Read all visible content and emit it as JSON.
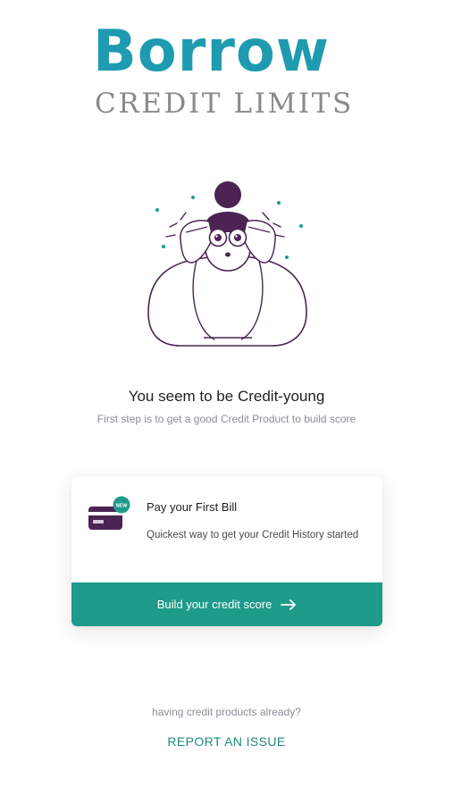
{
  "brand": {
    "title": "Borrow",
    "subtitle": "CREDIT LIMITS"
  },
  "hero": {
    "headline": "You seem to be Credit-young",
    "subline": "First step is to get a good Credit Product to build score"
  },
  "card": {
    "badge": "NEW",
    "title": "Pay your First Bill",
    "description": "Quickest way to get your Credit History started",
    "cta_label": "Build your credit score"
  },
  "footer": {
    "question": "having credit products already?",
    "report_label": "REPORT AN ISSUE"
  },
  "colors": {
    "brand": "#1e9bb0",
    "accent": "#1e9b8a",
    "illustration_dark": "#4b2454",
    "text_muted": "#8a8f95"
  }
}
